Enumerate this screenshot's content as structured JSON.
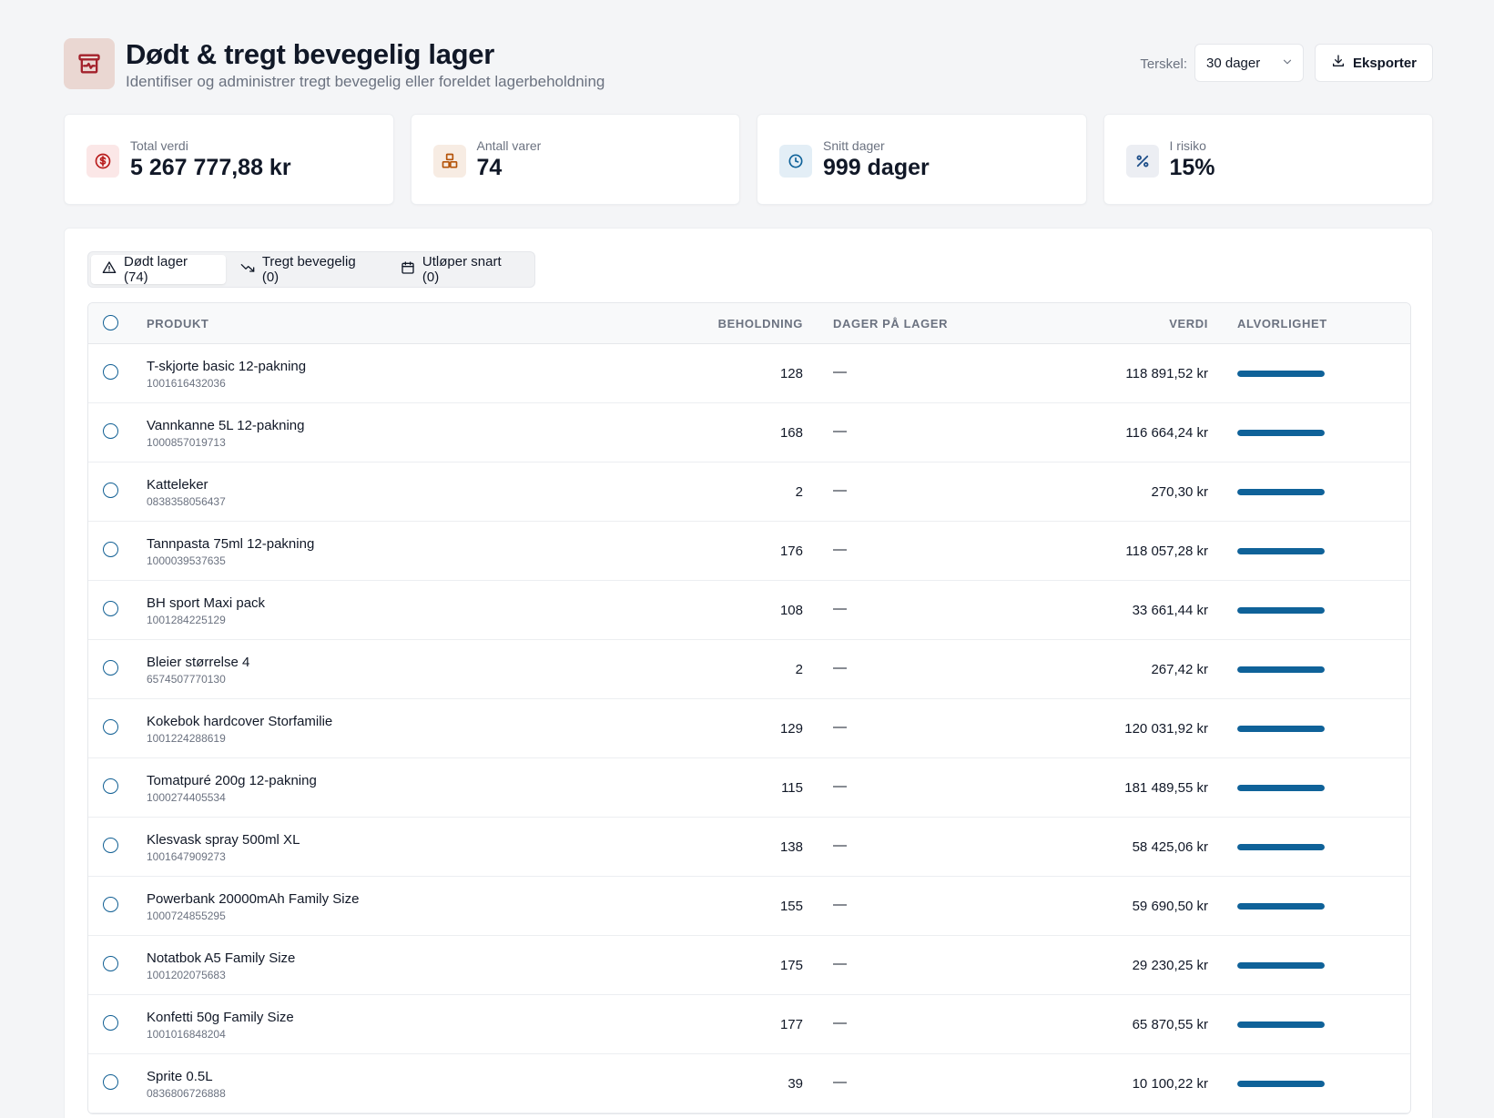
{
  "header": {
    "title": "Dødt & tregt bevegelig lager",
    "subtitle": "Identifiser og administrer tregt bevegelig eller foreldet lagerbeholdning",
    "threshold_label": "Terskel:",
    "threshold_value": "30 dager",
    "export_label": "Eksporter",
    "icon": "archive-box-icon",
    "accent": "#a3212b"
  },
  "kpis": [
    {
      "label": "Total verdi",
      "value": "5 267 777,88 kr",
      "icon": "dollar-circle-icon",
      "bg": "#fbe7e7",
      "color": "#b91c1c"
    },
    {
      "label": "Antall varer",
      "value": "74",
      "icon": "boxes-icon",
      "bg": "#f7ece3",
      "color": "#b45309"
    },
    {
      "label": "Snitt dager",
      "value": "999 dager",
      "icon": "clock-icon",
      "bg": "#e3eef6",
      "color": "#0f6299"
    },
    {
      "label": "I risiko",
      "value": "15%",
      "icon": "percent-icon",
      "bg": "#eceef3",
      "color": "#1f4f8a"
    }
  ],
  "tabs": [
    {
      "label": "Dødt lager (74)",
      "icon": "warning-triangle-icon",
      "active": true
    },
    {
      "label": "Tregt bevegelig (0)",
      "icon": "trending-down-icon",
      "active": false
    },
    {
      "label": "Utløper snart (0)",
      "icon": "calendar-icon",
      "active": false
    }
  ],
  "table": {
    "columns": {
      "product": "PRODUKT",
      "qty": "BEHOLDNING",
      "days": "DAGER PÅ LAGER",
      "value": "VERDI",
      "severity": "ALVORLIGHET"
    },
    "severity_color": "#0f6299",
    "rows": [
      {
        "name": "T-skjorte basic 12-pakning",
        "sku": "1001616432036",
        "qty": "128",
        "days": "—",
        "value": "118 891,52 kr",
        "severity": 1.0
      },
      {
        "name": "Vannkanne 5L 12-pakning",
        "sku": "1000857019713",
        "qty": "168",
        "days": "—",
        "value": "116 664,24 kr",
        "severity": 1.0
      },
      {
        "name": "Katteleker",
        "sku": "0838358056437",
        "qty": "2",
        "days": "—",
        "value": "270,30 kr",
        "severity": 1.0
      },
      {
        "name": "Tannpasta 75ml 12-pakning",
        "sku": "1000039537635",
        "qty": "176",
        "days": "—",
        "value": "118 057,28 kr",
        "severity": 1.0
      },
      {
        "name": "BH sport Maxi pack",
        "sku": "1001284225129",
        "qty": "108",
        "days": "—",
        "value": "33 661,44 kr",
        "severity": 1.0
      },
      {
        "name": "Bleier størrelse 4",
        "sku": "6574507770130",
        "qty": "2",
        "days": "—",
        "value": "267,42 kr",
        "severity": 1.0
      },
      {
        "name": "Kokebok hardcover Storfamilie",
        "sku": "1001224288619",
        "qty": "129",
        "days": "—",
        "value": "120 031,92 kr",
        "severity": 1.0
      },
      {
        "name": "Tomatpuré 200g 12-pakning",
        "sku": "1000274405534",
        "qty": "115",
        "days": "—",
        "value": "181 489,55 kr",
        "severity": 1.0
      },
      {
        "name": "Klesvask spray 500ml XL",
        "sku": "1001647909273",
        "qty": "138",
        "days": "—",
        "value": "58 425,06 kr",
        "severity": 1.0
      },
      {
        "name": "Powerbank 20000mAh Family Size",
        "sku": "1000724855295",
        "qty": "155",
        "days": "—",
        "value": "59 690,50 kr",
        "severity": 1.0
      },
      {
        "name": "Notatbok A5 Family Size",
        "sku": "1001202075683",
        "qty": "175",
        "days": "—",
        "value": "29 230,25 kr",
        "severity": 1.0
      },
      {
        "name": "Konfetti 50g Family Size",
        "sku": "1001016848204",
        "qty": "177",
        "days": "—",
        "value": "65 870,55 kr",
        "severity": 1.0
      },
      {
        "name": "Sprite 0.5L",
        "sku": "0836806726888",
        "qty": "39",
        "days": "—",
        "value": "10 100,22 kr",
        "severity": 1.0
      }
    ]
  }
}
